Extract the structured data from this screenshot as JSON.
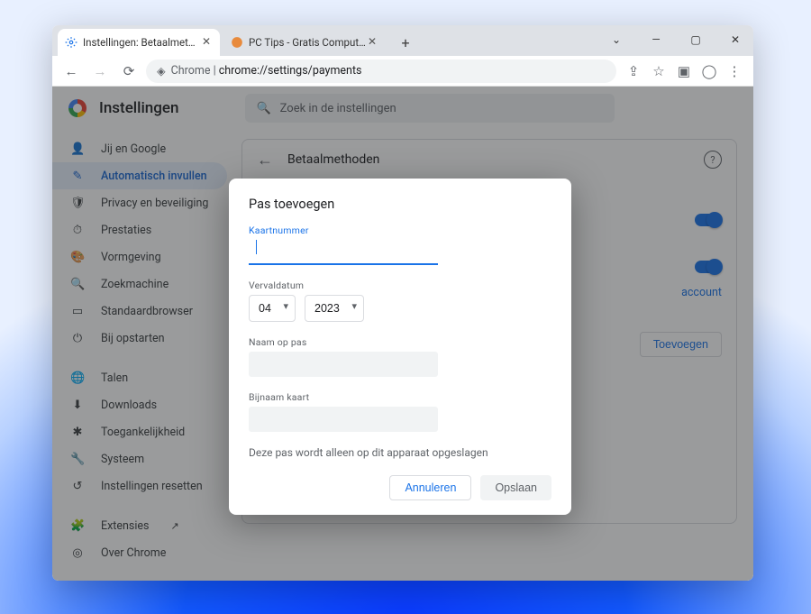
{
  "tabs": {
    "active": {
      "title": "Instellingen: Betaalmethoden"
    },
    "inactive": {
      "title": "PC Tips - Gratis Computer Tips,"
    }
  },
  "address_bar": {
    "prefix": "Chrome",
    "path": "chrome://settings/payments"
  },
  "settings": {
    "title": "Instellingen",
    "search_placeholder": "Zoek in de instellingen"
  },
  "sidebar": {
    "items": [
      {
        "icon": "user-icon",
        "label": "Jij en Google"
      },
      {
        "icon": "pen-icon",
        "label": "Automatisch invullen"
      },
      {
        "icon": "shield-icon",
        "label": "Privacy en beveiliging"
      },
      {
        "icon": "speed-icon",
        "label": "Prestaties"
      },
      {
        "icon": "paint-icon",
        "label": "Vormgeving"
      },
      {
        "icon": "search-icon",
        "label": "Zoekmachine"
      },
      {
        "icon": "browser-icon",
        "label": "Standaardbrowser"
      },
      {
        "icon": "power-icon",
        "label": "Bij opstarten"
      }
    ],
    "items2": [
      {
        "icon": "globe-icon",
        "label": "Talen"
      },
      {
        "icon": "download-icon",
        "label": "Downloads"
      },
      {
        "icon": "a11y-icon",
        "label": "Toegankelijkheid"
      },
      {
        "icon": "wrench-icon",
        "label": "Systeem"
      },
      {
        "icon": "reset-icon",
        "label": "Instellingen resetten"
      }
    ],
    "items3": [
      {
        "icon": "puzzle-icon",
        "label": "Extensies"
      },
      {
        "icon": "chrome-icon",
        "label": "Over Chrome"
      }
    ]
  },
  "card": {
    "title": "Betaalmethoden",
    "account_link_tail": "account",
    "add_button": "Toevoegen"
  },
  "modal": {
    "title": "Pas toevoegen",
    "card_number_label": "Kaartnummer",
    "expiry_label": "Vervaldatum",
    "month_value": "04",
    "year_value": "2023",
    "name_label": "Naam op pas",
    "nickname_label": "Bijnaam kaart",
    "note": "Deze pas wordt alleen op dit apparaat opgeslagen",
    "cancel": "Annuleren",
    "save": "Opslaan"
  }
}
